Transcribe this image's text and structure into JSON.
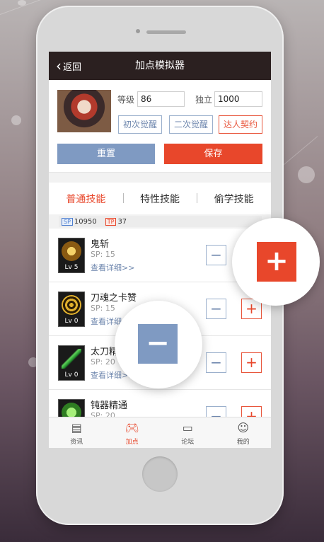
{
  "nav": {
    "back_label": "返回",
    "title": "加点模拟器"
  },
  "profile": {
    "level_label": "等级",
    "level_value": "86",
    "independent_label": "独立",
    "independent_value": "1000",
    "awaken_first": "初次觉醒",
    "awaken_second": "二次觉醒",
    "expert_contract": "达人契约",
    "reset_label": "重置",
    "save_label": "保存"
  },
  "tabs": [
    "普通技能",
    "特性技能",
    "偷学技能"
  ],
  "points": {
    "sp_tag": "SP",
    "sp_value": "10950",
    "tp_tag": "TP",
    "tp_value": "37"
  },
  "skills": [
    {
      "name": "鬼斩",
      "sp": "SP: 15",
      "link": "查看详细>>",
      "level": "Lv 5"
    },
    {
      "name": "刀魂之卡赞",
      "sp": "SP: 15",
      "link": "查看详细>>",
      "level": "Lv 0"
    },
    {
      "name": "太刀精通",
      "sp": "SP: 20",
      "link": "查看详细>>",
      "level": "Lv 0"
    },
    {
      "name": "钝器精通",
      "sp": "SP: 20",
      "link": "",
      "level": ""
    }
  ],
  "controls": {
    "minus": "−",
    "plus": "+"
  },
  "tabbar": [
    {
      "label": "资讯",
      "icon": "news-icon"
    },
    {
      "label": "加点",
      "icon": "gamepad-icon"
    },
    {
      "label": "论坛",
      "icon": "chat-icon"
    },
    {
      "label": "我的",
      "icon": "user-icon"
    }
  ],
  "colors": {
    "accent": "#e8472b",
    "blue": "#7f9ac2",
    "nav_bg": "#2b2020"
  }
}
